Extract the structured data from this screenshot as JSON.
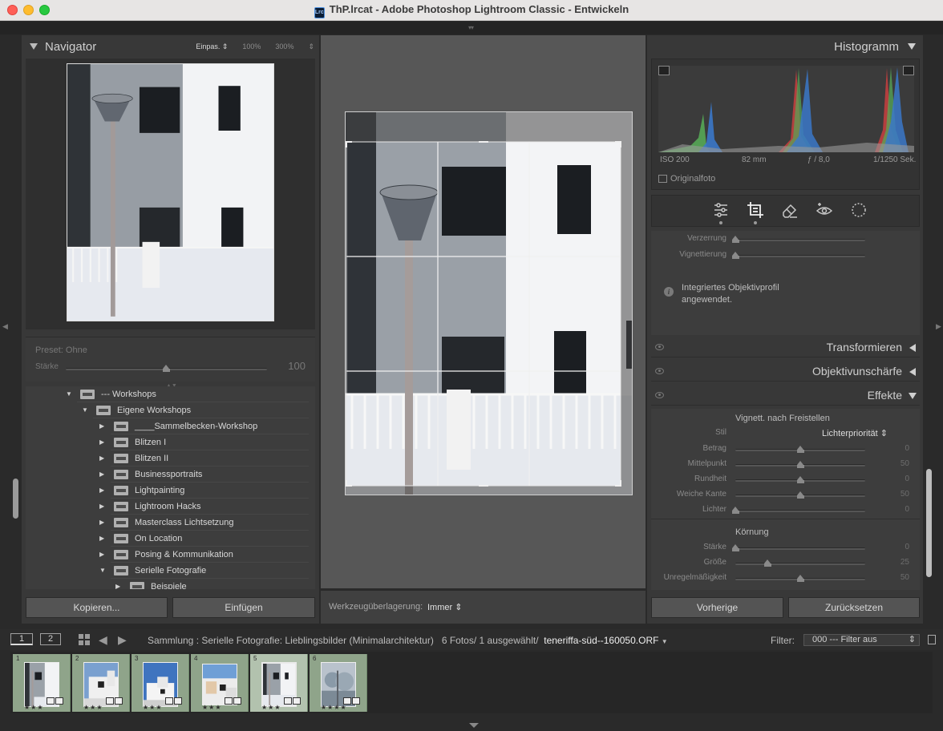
{
  "window": {
    "title": "ThP.lrcat - Adobe Photoshop Lightroom Classic - Entwickeln",
    "app_badge": "Lrc"
  },
  "navigator": {
    "title": "Navigator",
    "zoom_fit": "Einpas.",
    "zoom_100": "100%",
    "zoom_300": "300%",
    "preset_label": "Preset: Ohne",
    "strength_label": "Stärke",
    "strength_value": "100",
    "strength_fraction": 0.5
  },
  "folders": [
    {
      "label": "--- Workshops",
      "level": 0,
      "expanded": true
    },
    {
      "label": "Eigene Workshops",
      "level": 1,
      "expanded": true
    },
    {
      "label": "____Sammelbecken-Workshop",
      "level": 2,
      "expanded": false
    },
    {
      "label": "Blitzen I",
      "level": 2,
      "expanded": false
    },
    {
      "label": "Blitzen II",
      "level": 2,
      "expanded": false
    },
    {
      "label": "Businessportraits",
      "level": 2,
      "expanded": false
    },
    {
      "label": "Lightpainting",
      "level": 2,
      "expanded": false
    },
    {
      "label": "Lightroom Hacks",
      "level": 2,
      "expanded": false
    },
    {
      "label": "Masterclass Lichtsetzung",
      "level": 2,
      "expanded": false
    },
    {
      "label": "On Location",
      "level": 2,
      "expanded": false
    },
    {
      "label": "Posing & Kommunikation",
      "level": 2,
      "expanded": false
    },
    {
      "label": "Serielle Fotografie",
      "level": 2,
      "expanded": true
    },
    {
      "label": "Beispiele",
      "level": 3,
      "expanded": false
    }
  ],
  "left_buttons": {
    "copy": "Kopieren...",
    "paste": "Einfügen"
  },
  "toolbar": {
    "overlay_label": "Werkzeugüberlagerung:",
    "overlay_value": "Immer"
  },
  "histogram": {
    "title": "Histogramm",
    "iso": "ISO 200",
    "focal": "82 mm",
    "aperture": "ƒ / 8,0",
    "shutter": "1/1250 Sek.",
    "original": "Originalfoto"
  },
  "lens": {
    "sliders": [
      {
        "label": "Verzerrung",
        "fraction": 0.0
      },
      {
        "label": "Vignettierung",
        "fraction": 0.0
      }
    ],
    "info": "Integriertes Objektivprofil angewendet."
  },
  "sections": {
    "transform": "Transformieren",
    "sharpen": "Objektivunschärfe",
    "effects": "Effekte"
  },
  "effects": {
    "vignette_title": "Vignett. nach Freistellen",
    "style_label": "Stil",
    "style_value": "Lichterpriorität",
    "vignette": [
      {
        "label": "Betrag",
        "value": "0",
        "fraction": 0.5
      },
      {
        "label": "Mittelpunkt",
        "value": "50",
        "fraction": 0.5
      },
      {
        "label": "Rundheit",
        "value": "0",
        "fraction": 0.5
      },
      {
        "label": "Weiche Kante",
        "value": "50",
        "fraction": 0.5
      },
      {
        "label": "Lichter",
        "value": "0",
        "fraction": 0.0
      }
    ],
    "grain_title": "Körnung",
    "grain": [
      {
        "label": "Stärke",
        "value": "0",
        "fraction": 0.0
      },
      {
        "label": "Größe",
        "value": "25",
        "fraction": 0.25
      },
      {
        "label": "Unregelmäßigkeit",
        "value": "50",
        "fraction": 0.5
      }
    ]
  },
  "right_buttons": {
    "previous": "Vorherige",
    "reset": "Zurücksetzen"
  },
  "filmbar": {
    "screen1": "1",
    "screen2": "2",
    "collection": "Sammlung : Serielle Fotografie: Lieblingsbilder (Minimalarchitektur)",
    "count": "6 Fotos/ 1 ausgewählt/",
    "filename": "teneriffa-süd--160050.ORF",
    "filter_label": "Filter:",
    "filter_value": "000 --- Filter aus"
  },
  "filmstrip": [
    {
      "num": "1",
      "stars": "★★★"
    },
    {
      "num": "2",
      "stars": "★★★"
    },
    {
      "num": "3",
      "stars": "★★★"
    },
    {
      "num": "4",
      "stars": "★★★"
    },
    {
      "num": "5",
      "stars": "★★★"
    },
    {
      "num": "6",
      "stars": "★★★★"
    }
  ]
}
